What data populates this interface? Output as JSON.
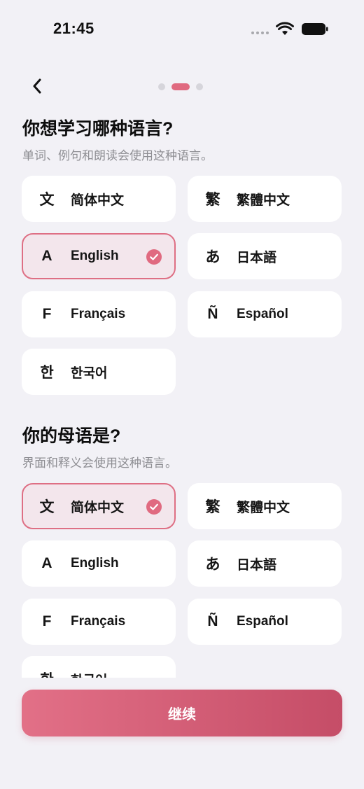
{
  "status_bar": {
    "time": "21:45"
  },
  "learn_section": {
    "title": "你想学习哪种语言?",
    "subtitle": "单词、例句和朗读会使用这种语言。",
    "options": [
      {
        "glyph": "文",
        "label": "简体中文",
        "selected": false
      },
      {
        "glyph": "繁",
        "label": "繁體中文",
        "selected": false
      },
      {
        "glyph": "A",
        "label": "English",
        "selected": true
      },
      {
        "glyph": "あ",
        "label": "日本語",
        "selected": false
      },
      {
        "glyph": "F",
        "label": "Français",
        "selected": false
      },
      {
        "glyph": "Ñ",
        "label": "Español",
        "selected": false
      },
      {
        "glyph": "한",
        "label": "한국어",
        "selected": false
      }
    ]
  },
  "native_section": {
    "title": "你的母语是?",
    "subtitle": "界面和释义会使用这种语言。",
    "options": [
      {
        "glyph": "文",
        "label": "简体中文",
        "selected": true
      },
      {
        "glyph": "繁",
        "label": "繁體中文",
        "selected": false
      },
      {
        "glyph": "A",
        "label": "English",
        "selected": false
      },
      {
        "glyph": "あ",
        "label": "日本語",
        "selected": false
      },
      {
        "glyph": "F",
        "label": "Français",
        "selected": false
      },
      {
        "glyph": "Ñ",
        "label": "Español",
        "selected": false
      },
      {
        "glyph": "한",
        "label": "한국어",
        "selected": false
      }
    ]
  },
  "pager": {
    "total": 3,
    "current": 2
  },
  "continue_label": "继续",
  "colors": {
    "accent": "#de6f84",
    "selected_bg": "#f3e6ec",
    "page_bg": "#f2f1f6"
  },
  "icons": {
    "back": "chevron-left-icon",
    "check": "check-circle-icon"
  }
}
